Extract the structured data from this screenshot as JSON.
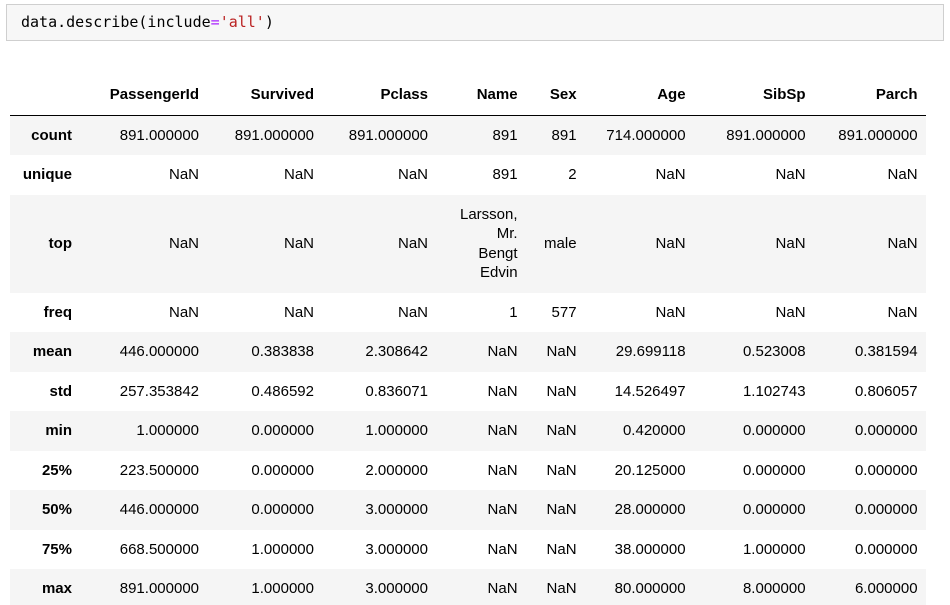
{
  "code_cell": {
    "tokens": [
      {
        "text": "data.describe(include",
        "type": "plain"
      },
      {
        "text": "=",
        "type": "operator"
      },
      {
        "text": "'all'",
        "type": "string"
      },
      {
        "text": ")",
        "type": "plain"
      }
    ]
  },
  "table": {
    "corner_label": "",
    "columns": [
      "PassengerId",
      "Survived",
      "Pclass",
      "Name",
      "Sex",
      "Age",
      "SibSp",
      "Parch"
    ],
    "rows": [
      {
        "label": "count",
        "values": [
          "891.000000",
          "891.000000",
          "891.000000",
          "891",
          "891",
          "714.000000",
          "891.000000",
          "891.000000"
        ]
      },
      {
        "label": "unique",
        "values": [
          "NaN",
          "NaN",
          "NaN",
          "891",
          "2",
          "NaN",
          "NaN",
          "NaN"
        ]
      },
      {
        "label": "top",
        "values": [
          "NaN",
          "NaN",
          "NaN",
          "Larsson, Mr. Bengt Edvin",
          "male",
          "NaN",
          "NaN",
          "NaN"
        ]
      },
      {
        "label": "freq",
        "values": [
          "NaN",
          "NaN",
          "NaN",
          "1",
          "577",
          "NaN",
          "NaN",
          "NaN"
        ]
      },
      {
        "label": "mean",
        "values": [
          "446.000000",
          "0.383838",
          "2.308642",
          "NaN",
          "NaN",
          "29.699118",
          "0.523008",
          "0.381594"
        ]
      },
      {
        "label": "std",
        "values": [
          "257.353842",
          "0.486592",
          "0.836071",
          "NaN",
          "NaN",
          "14.526497",
          "1.102743",
          "0.806057"
        ]
      },
      {
        "label": "min",
        "values": [
          "1.000000",
          "0.000000",
          "1.000000",
          "NaN",
          "NaN",
          "0.420000",
          "0.000000",
          "0.000000"
        ]
      },
      {
        "label": "25%",
        "values": [
          "223.500000",
          "0.000000",
          "2.000000",
          "NaN",
          "NaN",
          "20.125000",
          "0.000000",
          "0.000000"
        ]
      },
      {
        "label": "50%",
        "values": [
          "446.000000",
          "0.000000",
          "3.000000",
          "NaN",
          "NaN",
          "28.000000",
          "0.000000",
          "0.000000"
        ]
      },
      {
        "label": "75%",
        "values": [
          "668.500000",
          "1.000000",
          "3.000000",
          "NaN",
          "NaN",
          "38.000000",
          "1.000000",
          "0.000000"
        ]
      },
      {
        "label": "max",
        "values": [
          "891.000000",
          "1.000000",
          "3.000000",
          "NaN",
          "NaN",
          "80.000000",
          "8.000000",
          "6.000000"
        ]
      }
    ]
  },
  "colors": {
    "code_background": "#f7f7f7",
    "code_border": "#cfcfcf",
    "operator": "#AA22FF",
    "string": "#BA2121",
    "row_stripe": "#f5f5f5",
    "header_border": "#000000",
    "text": "#000000"
  }
}
